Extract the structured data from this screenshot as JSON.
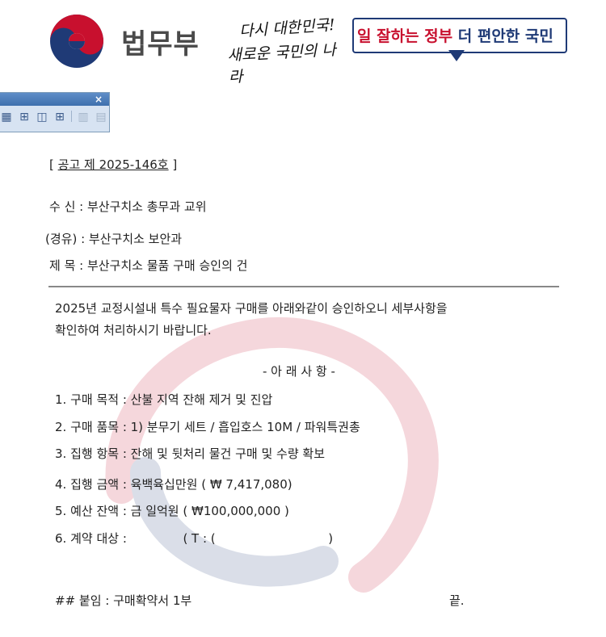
{
  "header": {
    "ministry_name": "법무부",
    "slogan_line1": "다시 대한민국!",
    "slogan_line2": "새로운 국민의 나라",
    "slogan_red": "일 잘하는 정부",
    "slogan_blue": "더 편안한 국민"
  },
  "toolbar": {
    "close_symbol": "×"
  },
  "document": {
    "notice_bracket_open": "[",
    "notice_number": "공고 제 2025-146호",
    "notice_bracket_close": "]",
    "recipient": "수 신 : 부산구치소 총무과 교위",
    "via": "(경유) : 부산구치소 보안과",
    "subject": "제 목 : 부산구치소 물품 구매 승인의 건",
    "body_line1": "2025년 교정시설내 특수 필요물자 구매를 아래와같이 승인하오니 세부사항을",
    "body_line2": "확인하여 처리하시기 바랍니다.",
    "section_heading": "- 아 래 사 항 -",
    "items": [
      "1. 구매 목적 :  산불 지역 잔해 제거 및 진압",
      "2. 구매 품목 : 1)  분무기 세트 / 흡입호스 10M / 파워특권총",
      "3. 집행 항목 : 잔해 및 뒷처리 물건 구매 및 수량 확보",
      "4. 집행 금액 : 육백육십만원 ( ₩ 7,417,080)",
      "5. 예산 잔액 : 금 일억원  ( ₩100,000,000 )"
    ],
    "item6_label": "6. 계약 대상 :",
    "item6_phone_open": "( T : (",
    "item6_phone_close": ")",
    "attachment": "## 붙임 : 구매확약서 1부",
    "end_mark": "끝."
  }
}
